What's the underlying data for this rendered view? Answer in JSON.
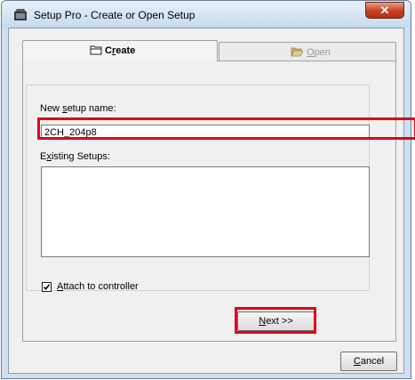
{
  "window": {
    "title": "Setup Pro - Create or Open Setup",
    "close_glyph": "✕"
  },
  "tabs": [
    {
      "label": "Create",
      "mnemonic": "r",
      "active": true,
      "icon": "folder-icon"
    },
    {
      "label": "Open",
      "mnemonic": "O",
      "active": false,
      "icon": "open-folder-icon"
    }
  ],
  "form": {
    "new_setup_label": "New setup name:",
    "new_setup_value": "2CH_204p8",
    "existing_label": "Existing Setups:",
    "existing_items": [],
    "attach_label": "Attach to controller",
    "attach_checked": true
  },
  "buttons": {
    "next": "Next >>",
    "cancel": "Cancel"
  },
  "colors": {
    "highlight": "#e0001b",
    "close_button": "#c9452a"
  }
}
